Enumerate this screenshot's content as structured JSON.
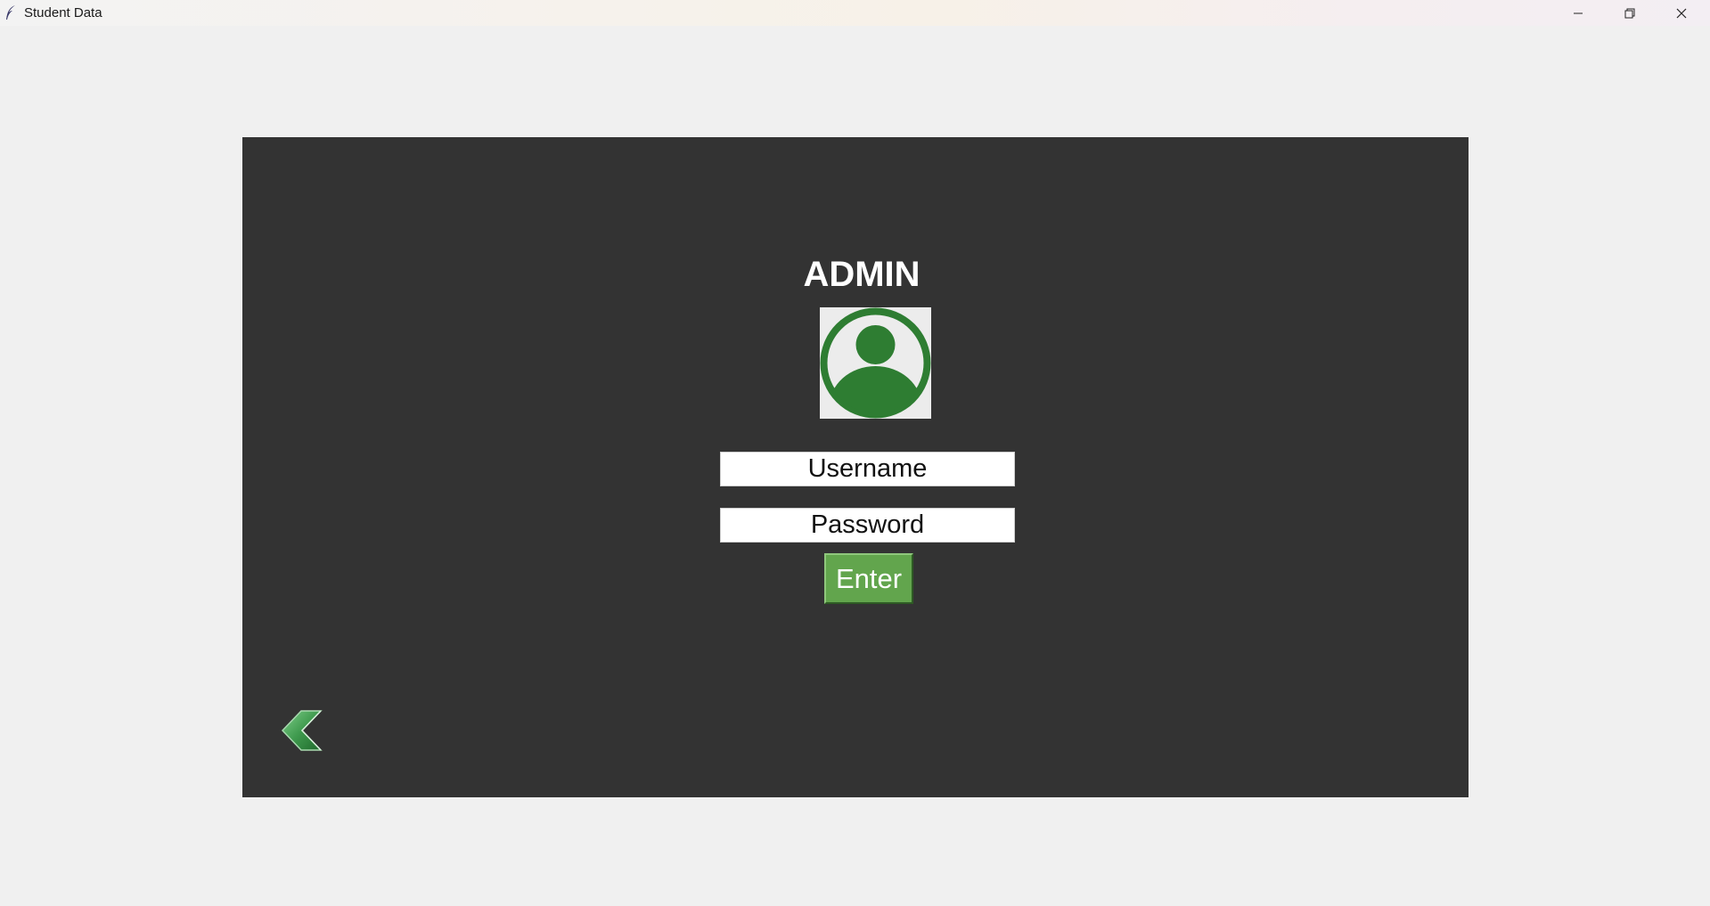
{
  "window": {
    "title": "Student Data",
    "controls": {
      "minimize_icon": "minimize-icon",
      "maximize_icon": "restore-icon",
      "close_icon": "close-icon"
    }
  },
  "login": {
    "heading": "ADMIN",
    "avatar_icon": "user-avatar-icon",
    "username_placeholder": "Username",
    "password_placeholder": "Password",
    "enter_label": "Enter",
    "back_icon": "back-chevron-icon"
  },
  "colors": {
    "panel_bg": "#333333",
    "accent_green": "#2e7d32",
    "button_green": "#62a54d",
    "window_bg": "#f0f0f0"
  }
}
